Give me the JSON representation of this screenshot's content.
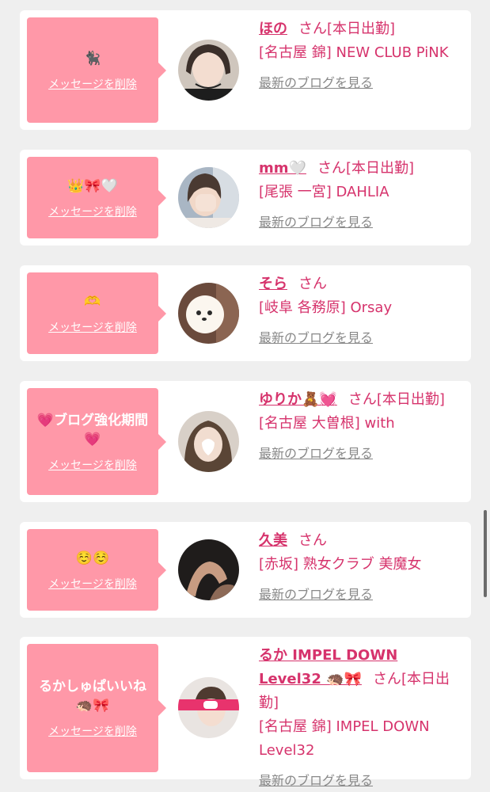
{
  "cards": [
    {
      "message": "🐈‍⬛",
      "delete_label": "メッセージを削除",
      "name": "ほの",
      "san": "さん",
      "status": "[本日出勤]",
      "area": "[名古屋 錦] NEW CLUB PiNK",
      "blog_label": "最新のブログを見る"
    },
    {
      "message": "👑🎀🤍",
      "delete_label": "メッセージを削除",
      "name": "mm🤍",
      "san": "さん",
      "status": "[本日出勤]",
      "area": "[尾張 一宮] DAHLIA",
      "blog_label": "最新のブログを見る"
    },
    {
      "message": "🫶",
      "delete_label": "メッセージを削除",
      "name": "そら",
      "san": "さん",
      "status": "",
      "area": "[岐阜 各務原] Orsay",
      "blog_label": "最新のブログを見る"
    },
    {
      "message": "💗ブログ強化期間💗",
      "delete_label": "メッセージを削除",
      "name": "ゆりか🧸💓",
      "san": "さん",
      "status": "[本日出勤]",
      "area": "[名古屋 大曽根] with",
      "blog_label": "最新のブログを見る"
    },
    {
      "message": "☺️☺️",
      "delete_label": "メッセージを削除",
      "name": "久美",
      "san": "さん",
      "status": "",
      "area": "[赤坂] 熟女クラブ 美魔女",
      "blog_label": "最新のブログを見る"
    },
    {
      "message": "るかしゅぱいいね🦔🎀",
      "delete_label": "メッセージを削除",
      "name": "るか IMPEL DOWN Level32 🦔🎀",
      "san": "さん",
      "status": "[本日出勤]",
      "area": "[名古屋 錦] IMPEL DOWN Level32",
      "blog_label": "最新のブログを見る"
    }
  ],
  "colors": {
    "accent": "#d6336c",
    "bubble": "#ff98a8",
    "link_gray": "#888888",
    "background": "#efefef"
  }
}
